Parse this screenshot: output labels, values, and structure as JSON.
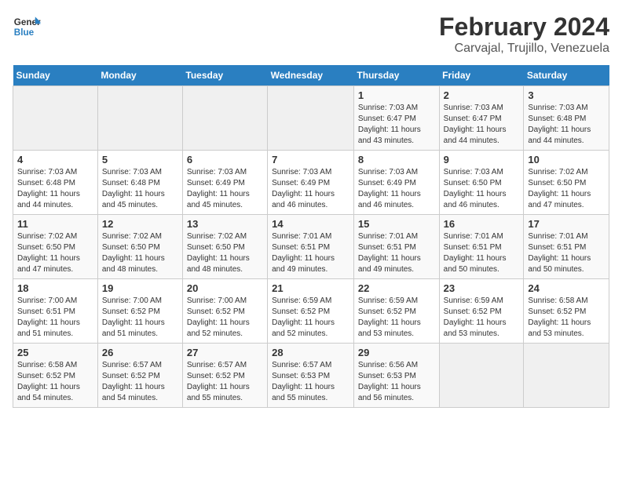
{
  "header": {
    "logo_line1": "General",
    "logo_line2": "Blue",
    "title": "February 2024",
    "subtitle": "Carvajal, Trujillo, Venezuela"
  },
  "weekdays": [
    "Sunday",
    "Monday",
    "Tuesday",
    "Wednesday",
    "Thursday",
    "Friday",
    "Saturday"
  ],
  "weeks": [
    [
      {
        "day": "",
        "empty": true
      },
      {
        "day": "",
        "empty": true
      },
      {
        "day": "",
        "empty": true
      },
      {
        "day": "",
        "empty": true
      },
      {
        "day": "1",
        "sunrise": "7:03 AM",
        "sunset": "6:47 PM",
        "daylight": "11 hours and 43 minutes."
      },
      {
        "day": "2",
        "sunrise": "7:03 AM",
        "sunset": "6:47 PM",
        "daylight": "11 hours and 44 minutes."
      },
      {
        "day": "3",
        "sunrise": "7:03 AM",
        "sunset": "6:48 PM",
        "daylight": "11 hours and 44 minutes."
      }
    ],
    [
      {
        "day": "4",
        "sunrise": "7:03 AM",
        "sunset": "6:48 PM",
        "daylight": "11 hours and 44 minutes."
      },
      {
        "day": "5",
        "sunrise": "7:03 AM",
        "sunset": "6:48 PM",
        "daylight": "11 hours and 45 minutes."
      },
      {
        "day": "6",
        "sunrise": "7:03 AM",
        "sunset": "6:49 PM",
        "daylight": "11 hours and 45 minutes."
      },
      {
        "day": "7",
        "sunrise": "7:03 AM",
        "sunset": "6:49 PM",
        "daylight": "11 hours and 46 minutes."
      },
      {
        "day": "8",
        "sunrise": "7:03 AM",
        "sunset": "6:49 PM",
        "daylight": "11 hours and 46 minutes."
      },
      {
        "day": "9",
        "sunrise": "7:03 AM",
        "sunset": "6:50 PM",
        "daylight": "11 hours and 46 minutes."
      },
      {
        "day": "10",
        "sunrise": "7:02 AM",
        "sunset": "6:50 PM",
        "daylight": "11 hours and 47 minutes."
      }
    ],
    [
      {
        "day": "11",
        "sunrise": "7:02 AM",
        "sunset": "6:50 PM",
        "daylight": "11 hours and 47 minutes."
      },
      {
        "day": "12",
        "sunrise": "7:02 AM",
        "sunset": "6:50 PM",
        "daylight": "11 hours and 48 minutes."
      },
      {
        "day": "13",
        "sunrise": "7:02 AM",
        "sunset": "6:50 PM",
        "daylight": "11 hours and 48 minutes."
      },
      {
        "day": "14",
        "sunrise": "7:01 AM",
        "sunset": "6:51 PM",
        "daylight": "11 hours and 49 minutes."
      },
      {
        "day": "15",
        "sunrise": "7:01 AM",
        "sunset": "6:51 PM",
        "daylight": "11 hours and 49 minutes."
      },
      {
        "day": "16",
        "sunrise": "7:01 AM",
        "sunset": "6:51 PM",
        "daylight": "11 hours and 50 minutes."
      },
      {
        "day": "17",
        "sunrise": "7:01 AM",
        "sunset": "6:51 PM",
        "daylight": "11 hours and 50 minutes."
      }
    ],
    [
      {
        "day": "18",
        "sunrise": "7:00 AM",
        "sunset": "6:51 PM",
        "daylight": "11 hours and 51 minutes."
      },
      {
        "day": "19",
        "sunrise": "7:00 AM",
        "sunset": "6:52 PM",
        "daylight": "11 hours and 51 minutes."
      },
      {
        "day": "20",
        "sunrise": "7:00 AM",
        "sunset": "6:52 PM",
        "daylight": "11 hours and 52 minutes."
      },
      {
        "day": "21",
        "sunrise": "6:59 AM",
        "sunset": "6:52 PM",
        "daylight": "11 hours and 52 minutes."
      },
      {
        "day": "22",
        "sunrise": "6:59 AM",
        "sunset": "6:52 PM",
        "daylight": "11 hours and 53 minutes."
      },
      {
        "day": "23",
        "sunrise": "6:59 AM",
        "sunset": "6:52 PM",
        "daylight": "11 hours and 53 minutes."
      },
      {
        "day": "24",
        "sunrise": "6:58 AM",
        "sunset": "6:52 PM",
        "daylight": "11 hours and 53 minutes."
      }
    ],
    [
      {
        "day": "25",
        "sunrise": "6:58 AM",
        "sunset": "6:52 PM",
        "daylight": "11 hours and 54 minutes."
      },
      {
        "day": "26",
        "sunrise": "6:57 AM",
        "sunset": "6:52 PM",
        "daylight": "11 hours and 54 minutes."
      },
      {
        "day": "27",
        "sunrise": "6:57 AM",
        "sunset": "6:52 PM",
        "daylight": "11 hours and 55 minutes."
      },
      {
        "day": "28",
        "sunrise": "6:57 AM",
        "sunset": "6:53 PM",
        "daylight": "11 hours and 55 minutes."
      },
      {
        "day": "29",
        "sunrise": "6:56 AM",
        "sunset": "6:53 PM",
        "daylight": "11 hours and 56 minutes."
      },
      {
        "day": "",
        "empty": true
      },
      {
        "day": "",
        "empty": true
      }
    ]
  ]
}
